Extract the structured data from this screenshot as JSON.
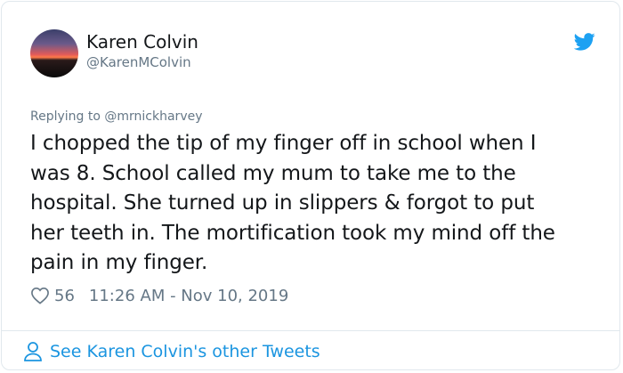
{
  "author": {
    "display_name": "Karen Colvin",
    "handle": "@KarenMColvin"
  },
  "reply": {
    "prefix": "Replying to ",
    "mention": "@mrnickharvey"
  },
  "tweet": {
    "lines": [
      "I chopped the tip of my finger off in school when I",
      "was 8. School called my mum to take me to the",
      "hospital. She turned up in slippers & forgot to put",
      "her teeth in. The mortification took my mind off the",
      "pain in my finger."
    ]
  },
  "meta": {
    "likes": "56",
    "timestamp": "11:26 AM - Nov 10, 2019"
  },
  "footer": {
    "see_more": "See Karen Colvin's other Tweets"
  },
  "colors": {
    "brand": "#1da1f2",
    "link": "#1b95e0",
    "muted": "#657786",
    "text": "#14171a"
  },
  "icons": {
    "brand": "twitter-bird-icon",
    "like": "heart-icon",
    "profile": "person-icon"
  }
}
